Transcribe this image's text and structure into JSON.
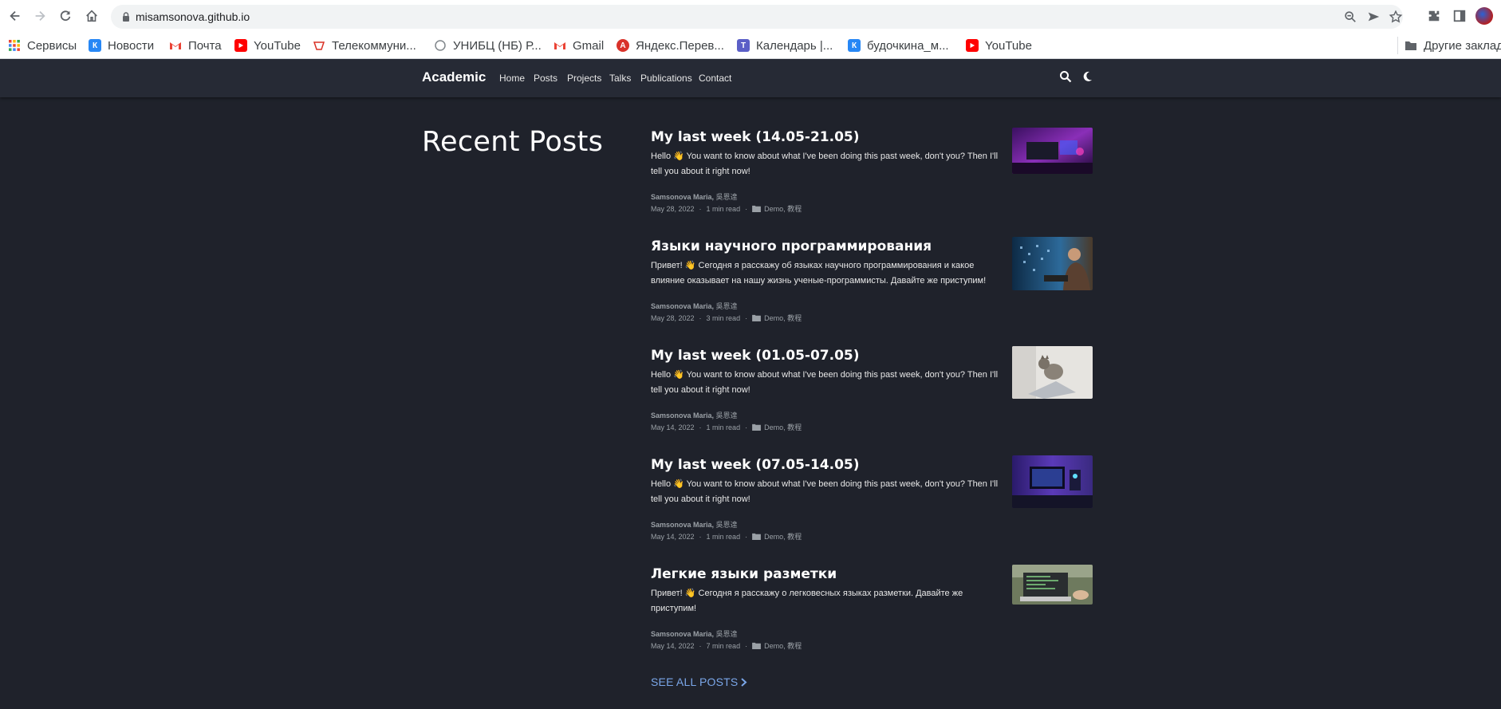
{
  "browser": {
    "url": "misamsonova.github.io",
    "bookmarks": [
      {
        "label": "Сервисы",
        "icon": "apps-grid-icon"
      },
      {
        "label": "Новости",
        "icon": "vk-icon"
      },
      {
        "label": "Почта",
        "icon": "gmail-icon"
      },
      {
        "label": "YouTube",
        "icon": "youtube-icon"
      },
      {
        "label": "Телекоммуни...",
        "icon": "telecom-icon"
      },
      {
        "label": "УНИБЦ (НБ) Р...",
        "icon": "library-icon"
      },
      {
        "label": "Gmail",
        "icon": "gmail-icon"
      },
      {
        "label": "Яндекс.Перев...",
        "icon": "yandex-translate-icon"
      },
      {
        "label": "Календарь |...",
        "icon": "calendar-icon"
      },
      {
        "label": "будочкина_м...",
        "icon": "vk-icon"
      },
      {
        "label": "YouTube",
        "icon": "youtube-icon"
      }
    ],
    "other_bookmarks": "Другие заклад"
  },
  "site": {
    "brand": "Academic",
    "nav": [
      "Home",
      "Posts",
      "Projects",
      "Talks",
      "Publications",
      "Contact"
    ]
  },
  "content": {
    "title": "Recent Posts",
    "posts": [
      {
        "title": "My last week (14.05-21.05)",
        "summary": "Hello 👋 You want to know about what I've been doing this past week, don't you? Then I'll tell you about it right now!",
        "author": "Samsonova Maria",
        "author2": "吳恩達",
        "date": "May 28, 2022",
        "read": "1 min read",
        "categories": "Demo, 教程",
        "thumb": "purple-room"
      },
      {
        "title": "Языки научного программирования",
        "summary": "Привет! 👋 Сегодня я расскажу об языках научного программирования и какое влияние оказывает на нашу жизнь ученые-программисты. Давайте же приступим!",
        "author": "Samsonova Maria",
        "author2": "吳恩達",
        "date": "May 28, 2022",
        "read": "3 min read",
        "categories": "Demo, 教程",
        "thumb": "code-person"
      },
      {
        "title": "My last week (01.05-07.05)",
        "summary": "Hello 👋 You want to know about what I've been doing this past week, don't you? Then I'll tell you about it right now!",
        "author": "Samsonova Maria",
        "author2": "吳恩達",
        "date": "May 14, 2022",
        "read": "1 min read",
        "categories": "Demo, 教程",
        "thumb": "cat-laptop"
      },
      {
        "title": "My last week (07.05-14.05)",
        "summary": "Hello 👋 You want to know about what I've been doing this past week, don't you? Then I'll tell you about it right now!",
        "author": "Samsonova Maria",
        "author2": "吳恩達",
        "date": "May 14, 2022",
        "read": "1 min read",
        "categories": "Demo, 教程",
        "thumb": "gaming-setup"
      },
      {
        "title": "Легкие языки разметки",
        "summary": "Привет! 👋 Сегодня я расскажу о легковесных языках разметки. Давайте же приступим!",
        "author": "Samsonova Maria",
        "author2": "吳恩達",
        "date": "May 14, 2022",
        "read": "7 min read",
        "categories": "Demo, 教程",
        "thumb": "laptop-desk"
      }
    ],
    "see_all": "SEE ALL POSTS"
  }
}
